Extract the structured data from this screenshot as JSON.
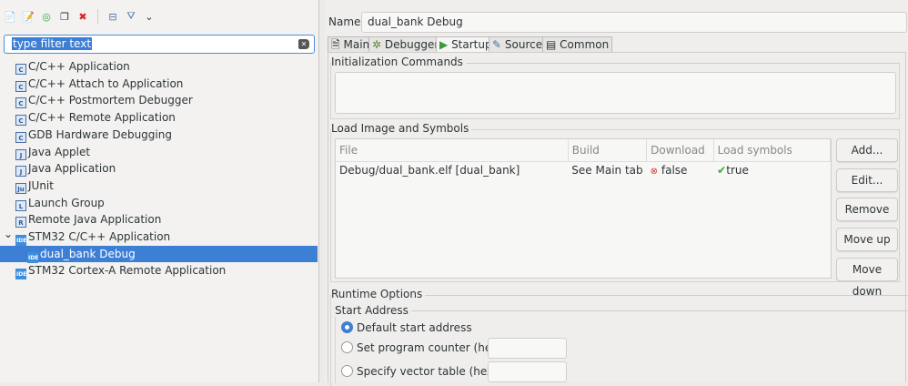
{
  "toolbar": {
    "icons": [
      "new-configuration-icon",
      "new-prototype-icon",
      "export-icon",
      "duplicate-icon",
      "delete-icon",
      "collapse-all-icon",
      "filter-icon",
      "dropdown-chevron-icon"
    ]
  },
  "filter": {
    "value": "type filter text"
  },
  "tree": [
    {
      "label": "C/C++ Application",
      "icon": "C"
    },
    {
      "label": "C/C++ Attach to Application",
      "icon": "C"
    },
    {
      "label": "C/C++ Postmortem Debugger",
      "icon": "C"
    },
    {
      "label": "C/C++ Remote Application",
      "icon": "C"
    },
    {
      "label": "GDB Hardware Debugging",
      "icon": "C"
    },
    {
      "label": "Java Applet",
      "icon": "J"
    },
    {
      "label": "Java Application",
      "icon": "J"
    },
    {
      "label": "JUnit",
      "icon": "Ju"
    },
    {
      "label": "Launch Group",
      "icon": "L"
    },
    {
      "label": "Remote Java Application",
      "icon": "R"
    },
    {
      "label": "STM32 C/C++ Application",
      "icon": "IDE"
    },
    {
      "label": "dual_bank Debug",
      "icon": "IDE"
    },
    {
      "label": "STM32 Cortex-A Remote Application",
      "icon": "IDE"
    }
  ],
  "name": {
    "label": "Name:",
    "value": "dual_bank Debug"
  },
  "tabs": [
    {
      "label": "Main"
    },
    {
      "label": "Debugger"
    },
    {
      "label": "Startup"
    },
    {
      "label": "Source"
    },
    {
      "label": "Common"
    }
  ],
  "init": {
    "title": "Initialization Commands"
  },
  "load": {
    "title": "Load Image and Symbols",
    "columns": [
      "File",
      "Build",
      "Download",
      "Load symbols"
    ],
    "rows": [
      {
        "file": "Debug/dual_bank.elf [dual_bank]",
        "build": "See Main tab",
        "download": "false",
        "symbols": "true"
      }
    ],
    "buttons": [
      "Add...",
      "Edit...",
      "Remove",
      "Move up",
      "Move down"
    ]
  },
  "runtime": {
    "title": "Runtime Options",
    "start_title": "Start Address",
    "options": [
      "Default start address",
      "Set program counter (hex):",
      "Specify vector table (hex):"
    ],
    "selected": 0
  },
  "colors": {
    "selection": "#3d7fd5",
    "accent": "#4a90d9"
  }
}
